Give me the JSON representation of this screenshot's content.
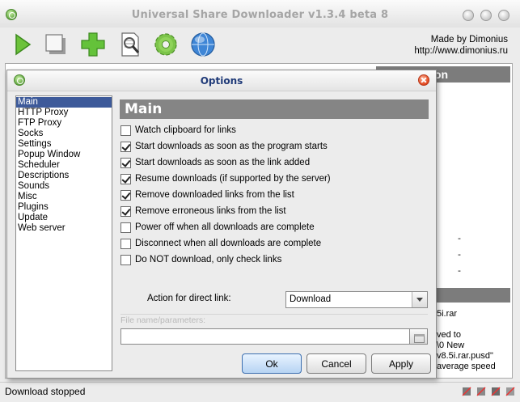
{
  "main_window": {
    "title": "Universal Share Downloader v1.3.4 beta 8",
    "credit_line1": "Made by Dimonius",
    "credit_line2": "http://www.dimonius.ru",
    "toolbar_icons": [
      "play-icon",
      "stop-icon",
      "add-icon",
      "properties-icon",
      "settings-icon",
      "globe-icon"
    ],
    "background_panel": {
      "header_text": "on",
      "texts": [
        "5i.rar",
        "ved to",
        "\\0 New",
        "v8.5i.rar.pusd\"",
        "average speed"
      ]
    },
    "status": "Download stopped"
  },
  "options_dialog": {
    "title": "Options",
    "categories": [
      {
        "label": "Main"
      },
      {
        "label": "HTTP Proxy"
      },
      {
        "label": "FTP Proxy"
      },
      {
        "label": "Socks"
      },
      {
        "label": "Settings"
      },
      {
        "label": "Popup Window"
      },
      {
        "label": "Scheduler"
      },
      {
        "label": "Descriptions"
      },
      {
        "label": "Sounds"
      },
      {
        "label": "Misc"
      },
      {
        "label": "Plugins"
      },
      {
        "label": "Update"
      },
      {
        "label": "Web server"
      }
    ],
    "selected_category": "Main",
    "section_title": "Main",
    "options": [
      {
        "label": "Watch clipboard for links",
        "checked": false
      },
      {
        "label": "Start downloads as soon as the program starts",
        "checked": true
      },
      {
        "label": "Start downloads as soon as the link added",
        "checked": true
      },
      {
        "label": "Resume downloads (if supported by the server)",
        "checked": true
      },
      {
        "label": "Remove downloaded links from the list",
        "checked": true
      },
      {
        "label": "Remove erroneous links from the list",
        "checked": true
      },
      {
        "label": "Power off when all downloads are complete",
        "checked": false
      },
      {
        "label": "Disconnect when all downloads are complete",
        "checked": false
      },
      {
        "label": "Do NOT download, only check links",
        "checked": false
      }
    ],
    "direct_link_label": "Action for direct link:",
    "direct_link_value": "Download",
    "filename_label": "File name/parameters:",
    "filename_value": "",
    "buttons": {
      "ok": "Ok",
      "cancel": "Cancel",
      "apply": "Apply"
    }
  },
  "colors": {
    "selection": "#3d5a9a",
    "section_header": "#858585",
    "dialog_title": "#1f3a78"
  }
}
